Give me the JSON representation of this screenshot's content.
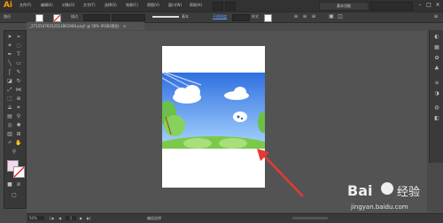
{
  "app": {
    "logo": "Ai",
    "menus": [
      "文件(F)",
      "编辑(E)",
      "对象(O)",
      "文字(T)",
      "选择(S)",
      "效果(C)",
      "视图(V)",
      "窗口(W)",
      "帮助(H)"
    ],
    "workspace": "基本功能",
    "window_controls": [
      "–",
      "□",
      "×"
    ]
  },
  "control_bar": {
    "selection_label": "路径",
    "stroke_label": "描边",
    "stroke_profile": "基本",
    "opacity_label": "不透明度",
    "style_label": "样式"
  },
  "document": {
    "tab_title": "_27155076252512861908.png* @ 50% (RGB/预览)",
    "close": "×"
  },
  "status": {
    "zoom": "50%",
    "page": "1",
    "tool": "编组选择"
  },
  "watermark": {
    "brand": "Bai",
    "brand_cn": "经验",
    "url": "jingyan.baidu.com"
  },
  "colors": {
    "chrome": "#323232",
    "workspace": "#535353",
    "accent": "#ff9a00",
    "arrow": "#e53935",
    "sky_top": "#2f6fe0",
    "sky_bottom": "#a9d6ff",
    "grass": "#7cc94a"
  },
  "icons": {
    "tools": [
      "selection-icon",
      "direct-selection-icon",
      "magic-wand-icon",
      "lasso-icon",
      "pen-icon",
      "type-icon",
      "line-icon",
      "rectangle-icon",
      "paintbrush-icon",
      "pencil-icon",
      "eraser-icon",
      "rotate-icon",
      "scale-icon",
      "width-icon",
      "free-transform-icon",
      "shape-builder-icon",
      "perspective-icon",
      "mesh-icon",
      "gradient-icon",
      "eyedropper-icon",
      "blend-icon",
      "symbol-sprayer-icon",
      "graph-icon",
      "artboard-icon",
      "slice-icon",
      "hand-icon",
      "zoom-icon"
    ],
    "right_panel": [
      "color-panel-icon",
      "swatches-icon",
      "brushes-icon",
      "symbols-icon",
      "stroke-icon",
      "transparency-icon",
      "appearance-icon",
      "layers-icon"
    ]
  }
}
